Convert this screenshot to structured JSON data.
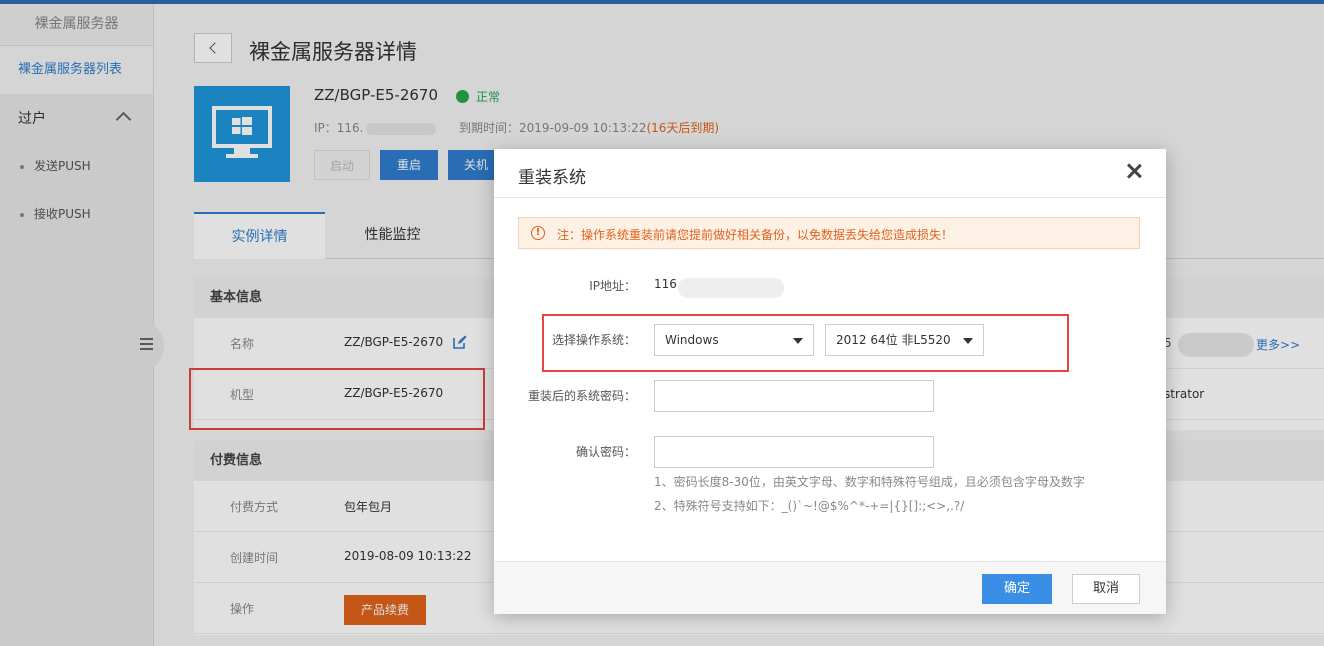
{
  "sidebar": {
    "header": "裸金属服务器",
    "active_item": "裸金属服务器列表",
    "group": "过户",
    "sub_items": [
      "发送PUSH",
      "接收PUSH"
    ]
  },
  "page": {
    "title": "裸金属服务器详情"
  },
  "server": {
    "name": "ZZ/BGP-E5-2670",
    "status": "正常",
    "ip_label": "IP：116.",
    "expire_label": "到期时间：2019-09-09 10:13:22",
    "expire_warn": "(16天后到期)",
    "buttons": {
      "start": "启动",
      "restart": "重启",
      "shutdown": "关机"
    }
  },
  "tabs": [
    "实例详情",
    "性能监控"
  ],
  "basic_info": {
    "heading": "基本信息",
    "rows": [
      {
        "key": "名称",
        "value": "ZZ/BGP-E5-2670"
      },
      {
        "key": "机型",
        "value": "ZZ/BGP-E5-2670"
      }
    ]
  },
  "billing_info": {
    "heading": "付费信息",
    "rows": [
      {
        "key": "付费方式",
        "value": "包年包月"
      },
      {
        "key": "创建时间",
        "value": "2019-08-09 10:13:22"
      },
      {
        "key": "操作",
        "value": ""
      }
    ],
    "renew_button": "产品续费"
  },
  "right_side": {
    "frag1": "5",
    "more_link": "更多>>",
    "frag2": "strator"
  },
  "modal": {
    "title": "重装系统",
    "notice": "注：操作系统重装前请您提前做好相关备份，以免数据丢失给您造成损失！",
    "ip_label": "IP地址：",
    "ip_value": "116.",
    "os_label": "选择操作系统：",
    "os_family": "Windows",
    "os_version": "2012 64位 非L5520",
    "pwd_label": "重装后的系统密码：",
    "confirm_label": "确认密码：",
    "hint1": "1、密码长度8-30位，由英文字母、数字和特殊符号组成，且必须包含字母及数字",
    "hint2": "2、特殊符号支持如下：_()`~!@$%^*-+=|{}[]:;<>,.?/",
    "ok": "确定",
    "cancel": "取消"
  },
  "colors": {
    "accent": "#2f7dcf",
    "status_ok": "#27a54a",
    "warning": "#e0621c",
    "highlight_box": "#e54545"
  }
}
